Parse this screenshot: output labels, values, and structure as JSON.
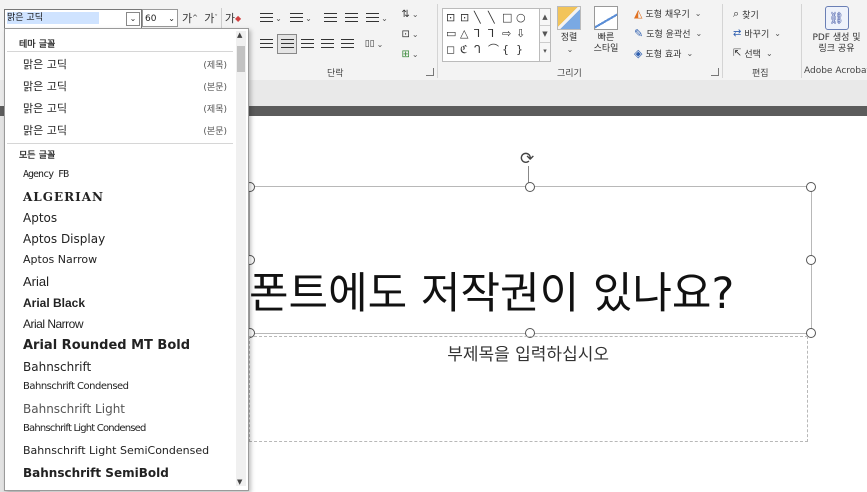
{
  "font_selector": {
    "current_font": "맑은 고딕",
    "current_size": "60",
    "grow_label": "가",
    "shrink_label": "가",
    "clear_label": "가"
  },
  "ribbon": {
    "paragraph_label": "단락",
    "drawing_label": "그리기",
    "editing_label": "편집",
    "adobe_label": "Adobe Acrobat",
    "arrange_label": "정렬",
    "quick_styles_label": "빠른\n스타일",
    "shape_fill_label": "도형 채우기",
    "shape_outline_label": "도형 윤곽선",
    "shape_effects_label": "도형 효과",
    "find_label": "찾기",
    "replace_label": "바꾸기",
    "select_label": "선택",
    "pdf_label": "PDF 생성 및\n링크 공유"
  },
  "font_dropdown": {
    "theme_header": "테마 글꼴",
    "all_header": "모든 글꼴",
    "theme_fonts": [
      {
        "name": "맑은 고딕",
        "tag": "(제목)"
      },
      {
        "name": "맑은 고딕",
        "tag": "(본문)"
      },
      {
        "name": "맑은 고딕",
        "tag": "(제목)"
      },
      {
        "name": "맑은 고딕",
        "tag": "(본문)"
      }
    ],
    "all_fonts": [
      "Agency FB",
      "ALGERIAN",
      "Aptos",
      "Aptos Display",
      "Aptos Narrow",
      "Arial",
      "Arial Black",
      "Arial Narrow",
      "Arial Rounded MT Bold",
      "Bahnschrift",
      "Bahnschrift Condensed",
      "Bahnschrift Light",
      "Bahnschrift Light Condensed",
      "Bahnschrift Light SemiCondensed",
      "Bahnschrift SemiBold"
    ]
  },
  "slide": {
    "title": "폰트에도 저작권이 있나요?",
    "subtitle": "부제목을 입력하십시오"
  }
}
